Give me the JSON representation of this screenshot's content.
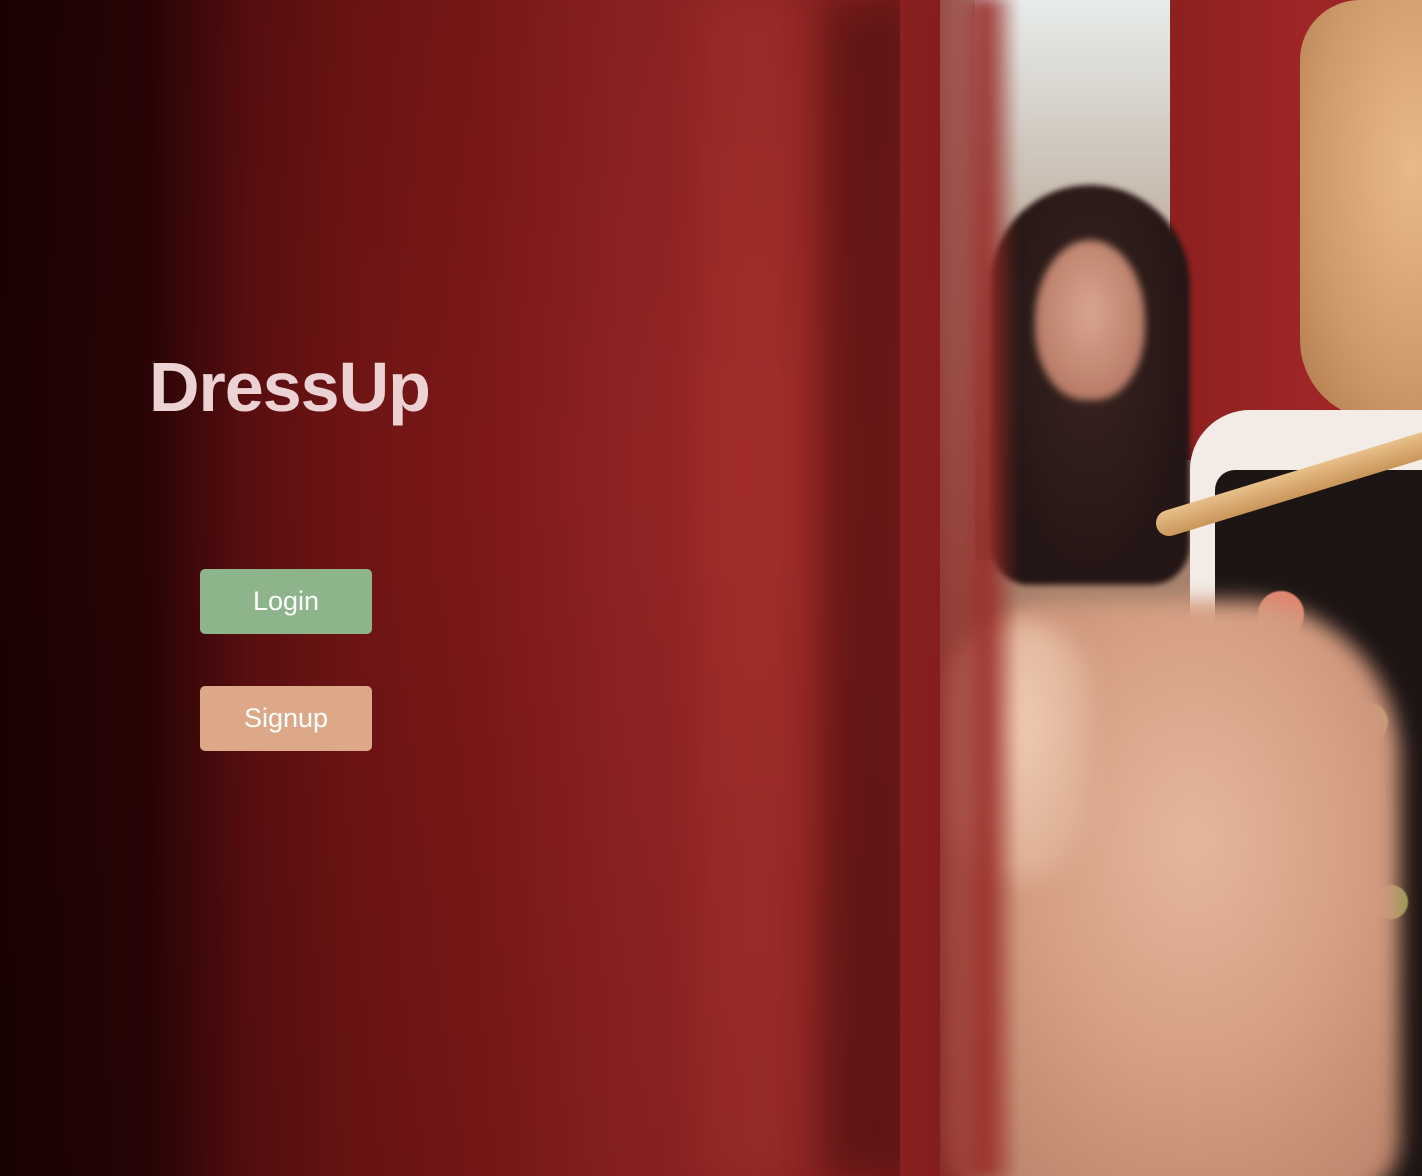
{
  "app": {
    "title": "DressUp"
  },
  "actions": {
    "login_label": "Login",
    "signup_label": "Signup"
  },
  "colors": {
    "title": "#ecd2d2",
    "login_button": "#8db48a",
    "signup_button": "#dca887",
    "curtain": "#7a1a1a"
  }
}
